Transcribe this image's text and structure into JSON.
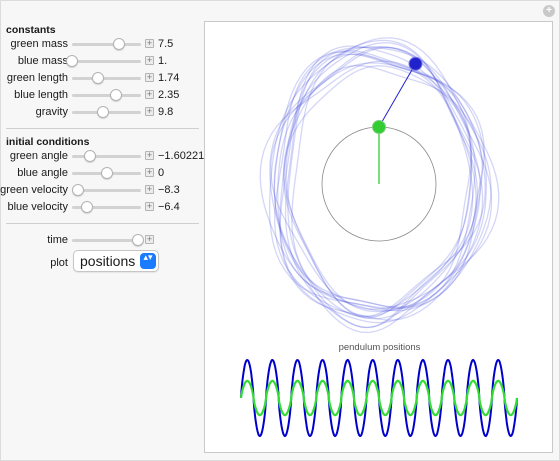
{
  "window": {
    "corner_button": "+"
  },
  "constants": {
    "title": "constants",
    "items": [
      {
        "label": "green mass",
        "value": "7.5",
        "fraction": 0.68
      },
      {
        "label": "blue mass",
        "value": "1.",
        "fraction": 0.0
      },
      {
        "label": "green length",
        "value": "1.74",
        "fraction": 0.38
      },
      {
        "label": "blue length",
        "value": "2.35",
        "fraction": 0.64
      },
      {
        "label": "gravity",
        "value": "9.8",
        "fraction": 0.45
      }
    ]
  },
  "initial_conditions": {
    "title": "initial conditions",
    "items": [
      {
        "label": "green angle",
        "value": "−1.60221",
        "fraction": 0.26
      },
      {
        "label": "blue angle",
        "value": "0",
        "fraction": 0.5
      },
      {
        "label": "green velocity",
        "value": "−8.3",
        "fraction": 0.09
      },
      {
        "label": "blue velocity",
        "value": "−6.4",
        "fraction": 0.22
      }
    ]
  },
  "time": {
    "label": "time",
    "fraction": 0.95
  },
  "plot": {
    "label": "plot",
    "selected": "positions",
    "chevron": "▴▾"
  },
  "pendulum": {
    "green_angle_deg": 0,
    "blue_angle_deg": 30,
    "green_color": "#33cc33",
    "blue_color": "#2222cc"
  },
  "chart_data": {
    "type": "line",
    "title": "pendulum positions",
    "series": [
      {
        "name": "",
        "color": "#0000cc",
        "amplitude": 1.0,
        "cycles": 11
      },
      {
        "name": "",
        "color": "#33dd33",
        "amplitude": 0.45,
        "cycles": 11
      }
    ],
    "grid": false,
    "axes": false
  }
}
